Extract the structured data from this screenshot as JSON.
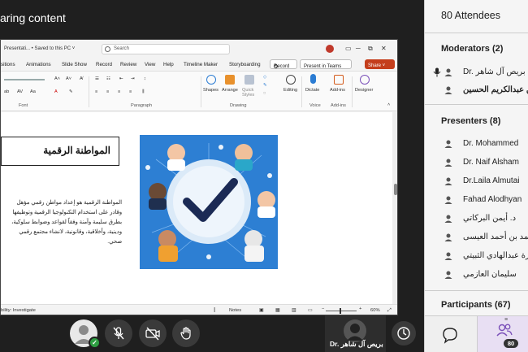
{
  "meeting": {
    "sharing_title": "aring content",
    "self_tile_name": "Dr. بريص آل شاهر"
  },
  "powerpoint": {
    "doc_title": "Presentati... • Saved to this PC ˅",
    "search_placeholder": "Search",
    "menu": [
      "sitions",
      "Animations",
      "Slide Show",
      "Record",
      "Review",
      "View",
      "Help",
      "Timeline Maker",
      "Storyboarding"
    ],
    "record_label": "Record",
    "present_teams_label": "Present in Teams",
    "share_label": "Share ˅",
    "ribbon": {
      "font_label": "Font",
      "paragraph_label": "Paragraph",
      "drawing_label": "Drawing",
      "voice_label": "Voice",
      "addins_label": "Add-ins",
      "shapes": "Shapes",
      "arrange": "Arrange",
      "quick_styles": "Quick Styles",
      "editing": "Editing",
      "dictate": "Dictate",
      "addins": "Add-ins",
      "designer": "Designer"
    },
    "slide": {
      "title": "المواطنة الرقمية",
      "body": "المواطنة الرقمية هو إعداد مواطن رقمي مؤهل وقادر على استخدام التكنولوجيا الرقمية وتوظيفها بطرق سليمة وآمنة وفقاً لقواعد وضوابط سلوكية، ودينية، وأخلاقية، وقانونية، لانشاء مجتمع رقمي صحي."
    },
    "status": {
      "accessibility": "bility: Investigate",
      "notes": "Notes",
      "zoom": "60%"
    }
  },
  "panel": {
    "title": "80 Attendees",
    "moderators_title": "Moderators (2)",
    "moderators": [
      "Dr. بريص آل شاهر",
      "د بن عبدالكريم الحسين"
    ],
    "presenters_title": "Presenters (8)",
    "presenters": [
      "Dr. Mohammed",
      "Dr. Naif Alsham",
      "Dr.Laila Almutai",
      "Fahad Alodhyan",
      "د. أيمن البركاتي",
      "محمد بن أحمد العيسى",
      "سارة عبدالهادي الثبيتي",
      "سليمان العازمي"
    ],
    "participants_title": "Participants (67)",
    "people_count": "80"
  },
  "colors": {
    "share_button": "#c43e1c",
    "ok_badge": "#2e9e42",
    "people_tab": "#e8dff3"
  }
}
